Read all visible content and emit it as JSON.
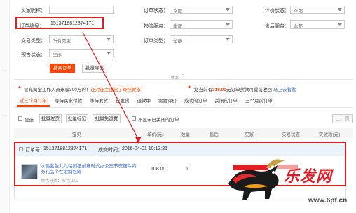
{
  "filters": {
    "buyer_nick_label": "买家昵称：",
    "order_status_label": "订单状态：",
    "order_status_value": "全部",
    "eval_status_label": "评价状态：",
    "eval_status_value": "全部",
    "order_no_label": "订单编号：",
    "order_no_value": "1513718812374171",
    "logistics_label": "物流服务：",
    "logistics_value": "全部",
    "aftersale_label": "售后服务：",
    "aftersale_value": "全部",
    "trade_type_label": "交易类型：",
    "trade_type_value": "所有类型",
    "order_type_label": "订单类型：",
    "order_type_value": "全部",
    "presale_label": "预售状态：",
    "presale_value": "全部",
    "search_btn": "搜索订单",
    "export_btn": "批量导出",
    "collapse": "收起"
  },
  "notices": {
    "left_prefix": "冒充淘宝工作人员来骗300万的！",
    "left_suffix": "还对连主提出了奇怪要求！",
    "right_prefix": "您当前有",
    "right_amount": "318.00",
    "right_mid": "元订单货款可提前收回",
    "right_link": "马上去看看"
  },
  "tabs": [
    "近三个月订单",
    "等待买家付款",
    "等待发货",
    "已发货",
    "退款中",
    "需要评价",
    "成功的订单",
    "关闭的订单",
    "三个月前订单"
  ],
  "bulk": {
    "select_all": "全选",
    "batch_ship": "批量发货",
    "batch_mark": "批量标记",
    "batch_free": "批量免运费",
    "hide_closed": "不显示已关闭的订单",
    "prev_page": "上一页"
  },
  "columns": [
    "宝贝",
    "单价(元)",
    "数量",
    "售后",
    "买家",
    "交易状态",
    "实收款(元)"
  ],
  "order": {
    "order_no_label": "订单号：",
    "order_no": "1513718812374171",
    "deal_time_label": "成交时间：",
    "deal_time": "2016-04-01 10:13:21",
    "item_title": "水晶蓝色九九铭刻钮创意时式办公室节庆摆件商务礼品个性定制包邮",
    "item_attr": "颜色分类：彩色江山",
    "price": "108.00",
    "qty": "1"
  },
  "watermark": {
    "site": "www.6pf.cn"
  },
  "colors": {
    "accent": "#ff4400",
    "annotation": "#e51c23"
  }
}
